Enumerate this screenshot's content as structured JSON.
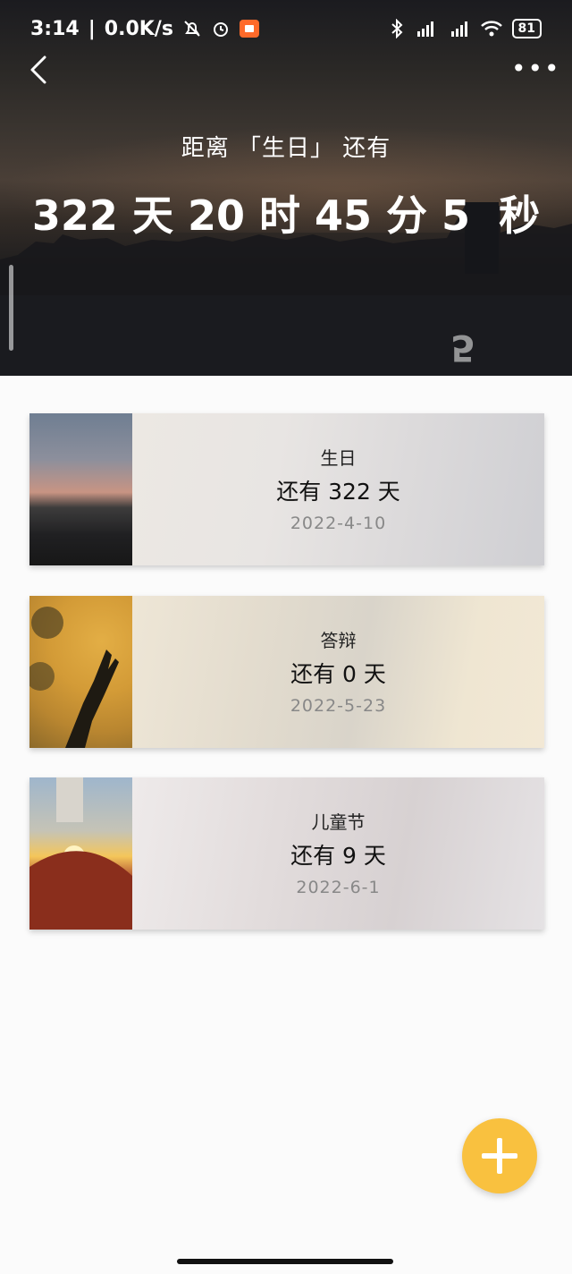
{
  "status_bar": {
    "time": "3:14",
    "network_speed": "0.0K/s",
    "icons_left": [
      "mute-bell-icon",
      "alarm-icon",
      "screen-record-icon"
    ],
    "icons_right": [
      "bluetooth-icon",
      "signal-hd-icon",
      "signal-hd-icon",
      "wifi-icon"
    ],
    "battery": "81"
  },
  "header": {
    "back_icon": "chevron-left-icon",
    "more_icon": "more-dots-icon",
    "more_glyph": "•••",
    "caption": "距离 「生日」 还有",
    "countdown": "322 天 20 时 45 分 5  秒",
    "page_digit": "5"
  },
  "events": [
    {
      "title": "生日",
      "remaining": "还有 322 天",
      "date": "2022-4-10"
    },
    {
      "title": "答辩",
      "remaining": "还有 0 天",
      "date": "2022-5-23"
    },
    {
      "title": "儿童节",
      "remaining": "还有 9 天",
      "date": "2022-6-1"
    }
  ],
  "fab": {
    "icon": "plus-icon"
  },
  "colors": {
    "accent": "#f9c13f",
    "record_badge": "#ff6a2a"
  }
}
